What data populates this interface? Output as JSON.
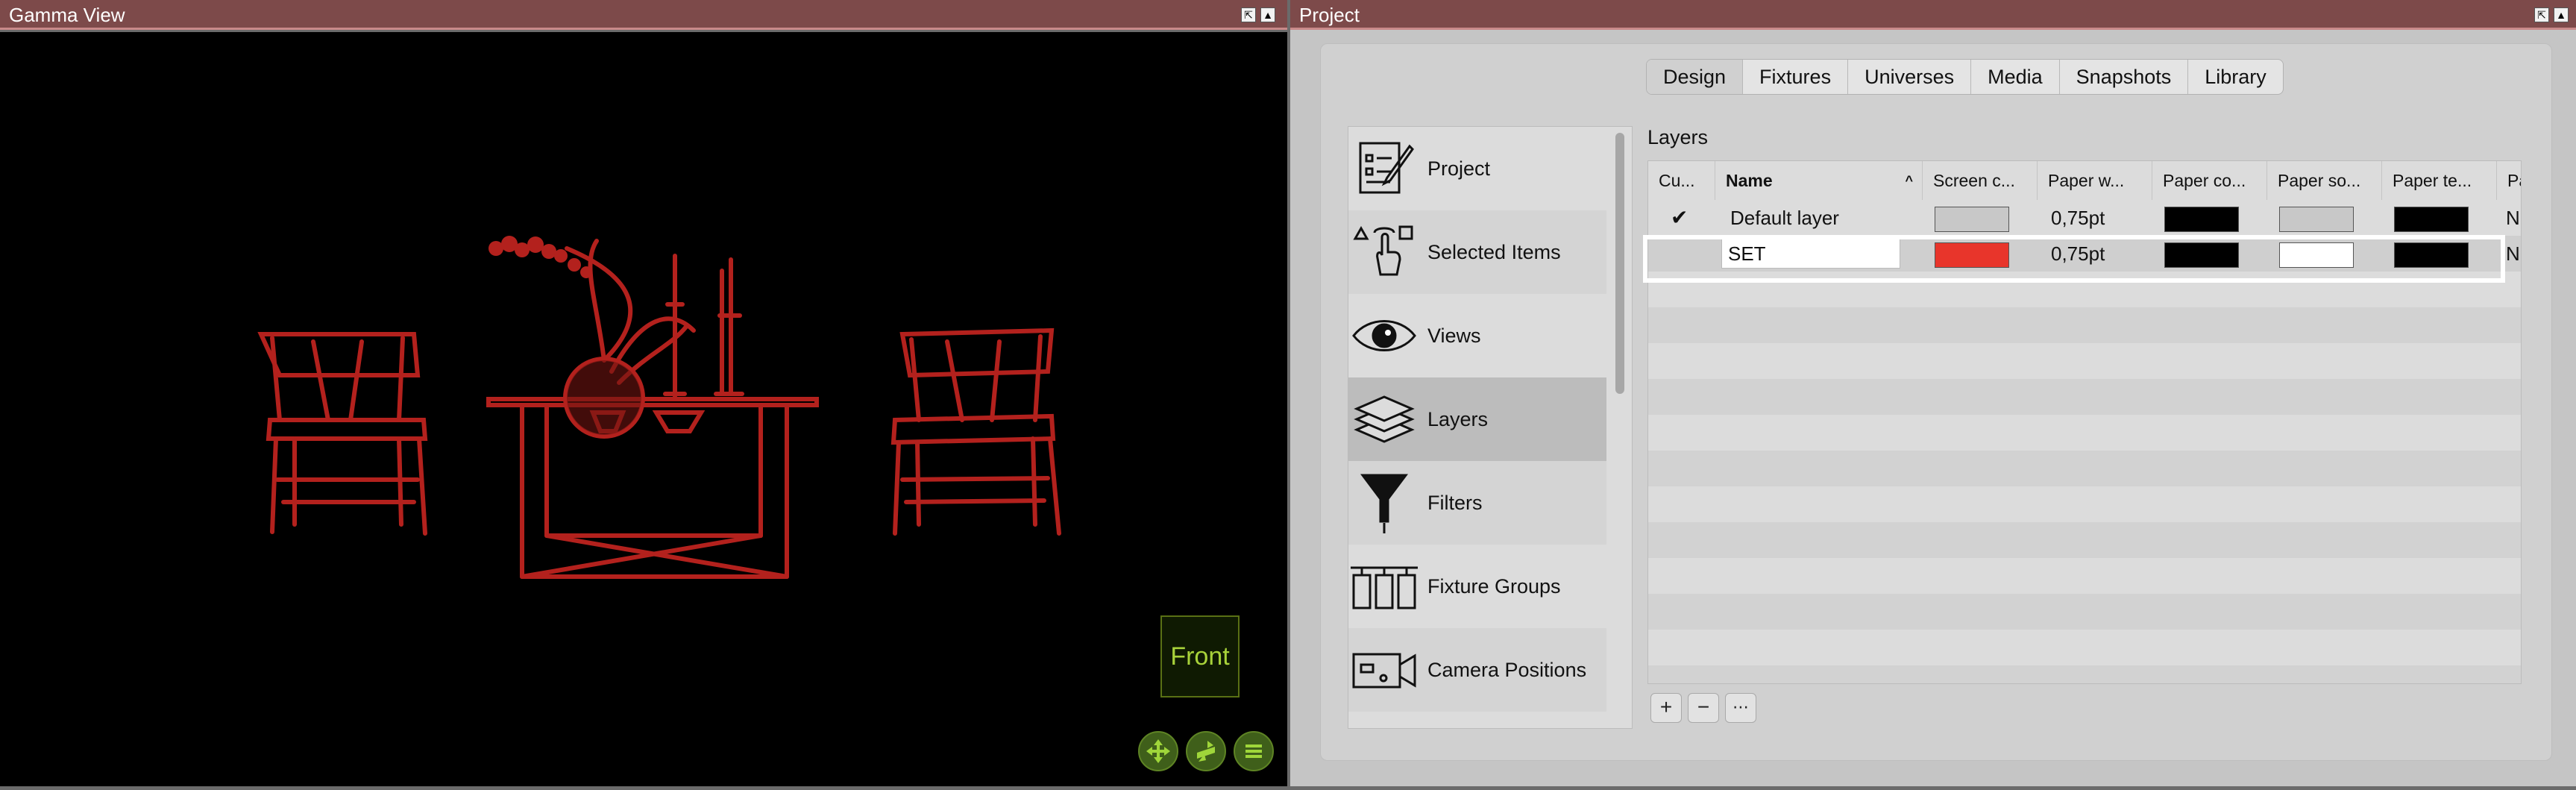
{
  "gamma": {
    "title": "Gamma View",
    "front_label": "Front",
    "scene_color": "#b3211d",
    "nav_icons": [
      "move-arrows-icon",
      "reposition-icon",
      "menu-icon"
    ]
  },
  "project": {
    "title": "Project",
    "tabs": [
      {
        "label": "Design",
        "active": true
      },
      {
        "label": "Fixtures",
        "active": false
      },
      {
        "label": "Universes",
        "active": false
      },
      {
        "label": "Media",
        "active": false
      },
      {
        "label": "Snapshots",
        "active": false
      },
      {
        "label": "Library",
        "active": false
      }
    ],
    "sidebar": [
      {
        "label": "Project",
        "icon": "project-notes-icon"
      },
      {
        "label": "Selected Items",
        "icon": "selected-items-icon"
      },
      {
        "label": "Views",
        "icon": "eye-icon"
      },
      {
        "label": "Layers",
        "icon": "layers-icon",
        "selected": true
      },
      {
        "label": "Filters",
        "icon": "funnel-icon"
      },
      {
        "label": "Fixture Groups",
        "icon": "fixture-groups-icon"
      },
      {
        "label": "Camera Positions",
        "icon": "camera-icon"
      }
    ],
    "layers": {
      "title": "Layers",
      "columns": [
        "Cu...",
        "Name",
        "Screen c...",
        "Paper w...",
        "Paper co...",
        "Paper so...",
        "Paper te...",
        "Pa"
      ],
      "sort_indicator": "^",
      "rows": [
        {
          "current": "✔",
          "name": "Default layer",
          "screen_color": "#c8c8c8",
          "paper_width": "0,75pt",
          "paper_color": "#000000",
          "paper_solid": "#c8c8c8",
          "paper_text": "#000000",
          "extra": "N"
        },
        {
          "current": "",
          "name": "SET",
          "screen_color": "#e8352b",
          "paper_width": "0,75pt",
          "paper_color": "#000000",
          "paper_solid": "#ffffff",
          "paper_text": "#000000",
          "extra": "N"
        }
      ],
      "buttons": [
        "+",
        "−",
        "⋯"
      ]
    }
  }
}
